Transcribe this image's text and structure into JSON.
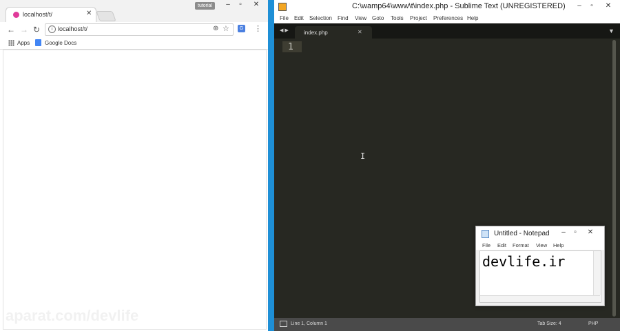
{
  "chrome": {
    "profile_label": "tutorial",
    "tab_title": "localhost/t/",
    "address": "localhost/t/",
    "bookmarks": [
      {
        "label": "Apps",
        "icon": "apps-icon"
      },
      {
        "label": "Google Docs",
        "icon": "google-docs-icon"
      }
    ],
    "watermark": "aparat.com/devlife"
  },
  "sublime": {
    "window_title": "C:\\wamp64\\www\\t\\index.php - Sublime Text (UNREGISTERED)",
    "menu": [
      "File",
      "Edit",
      "Selection",
      "Find",
      "View",
      "Goto",
      "Tools",
      "Project",
      "Preferences",
      "Help"
    ],
    "tab_name": "index.php",
    "line_number": "1",
    "status_position": "Line 1, Column 1",
    "status_tab_size": "Tab Size: 4",
    "status_syntax": "PHP"
  },
  "notepad": {
    "window_title": "Untitled - Notepad",
    "menu": [
      "File",
      "Edit",
      "Format",
      "View",
      "Help"
    ],
    "content": "devlife.ir"
  },
  "colors": {
    "desktop": "#1e8fd6",
    "sublime_bg": "#272822",
    "chrome_favicon": "#e03a9a"
  }
}
